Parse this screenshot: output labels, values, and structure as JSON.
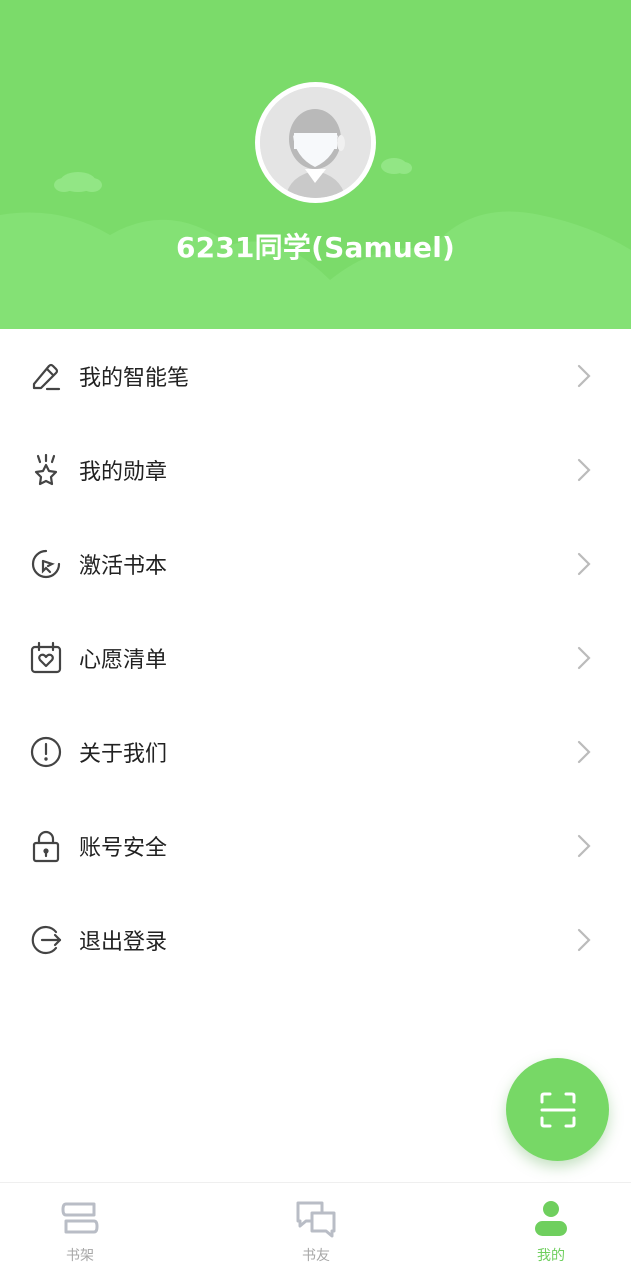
{
  "profile": {
    "username": "6231同学(Samuel)"
  },
  "colors": {
    "header_bg": "#7bdb6a",
    "accent": "#6fcf5e",
    "icon_gray": "#555555",
    "tab_inactive": "#a7a7a7"
  },
  "menu": {
    "items": [
      {
        "label": "我的智能笔",
        "icon": "pen-icon"
      },
      {
        "label": "我的勋章",
        "icon": "medal-star-icon"
      },
      {
        "label": "激活书本",
        "icon": "activate-cursor-icon"
      },
      {
        "label": "心愿清单",
        "icon": "calendar-heart-icon"
      },
      {
        "label": "关于我们",
        "icon": "info-exclamation-icon"
      },
      {
        "label": "账号安全",
        "icon": "lock-icon"
      },
      {
        "label": "退出登录",
        "icon": "logout-icon"
      }
    ]
  },
  "fab": {
    "icon": "scan-icon"
  },
  "tabbar": {
    "tabs": [
      {
        "label": "书架",
        "icon": "bookshelf-icon",
        "active": false
      },
      {
        "label": "书友",
        "icon": "chat-bubbles-icon",
        "active": false
      },
      {
        "label": "我的",
        "icon": "user-icon",
        "active": true
      }
    ]
  }
}
